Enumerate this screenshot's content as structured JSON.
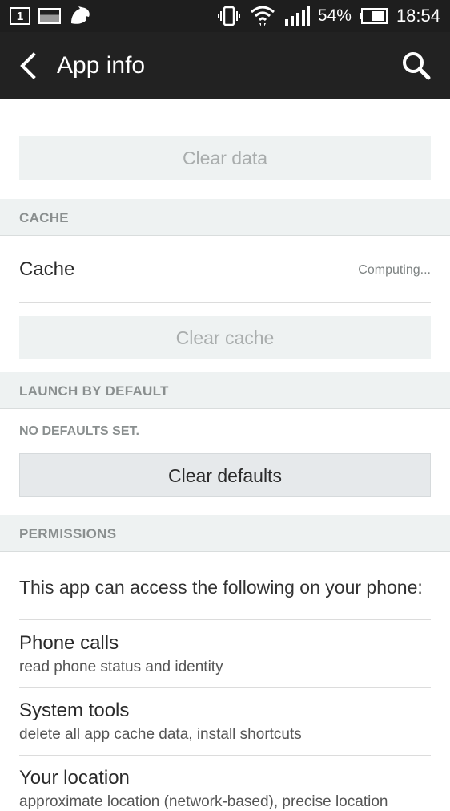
{
  "status_bar": {
    "notification_count": "1",
    "battery_percent": "54%",
    "time": "18:54"
  },
  "app_bar": {
    "title": "App info"
  },
  "storage": {
    "clear_data_label": "Clear data"
  },
  "cache": {
    "header": "CACHE",
    "label": "Cache",
    "value": "Computing...",
    "clear_cache_label": "Clear cache"
  },
  "launch_by_default": {
    "header": "LAUNCH BY DEFAULT",
    "status": "NO DEFAULTS SET.",
    "clear_defaults_label": "Clear defaults"
  },
  "permissions": {
    "header": "PERMISSIONS",
    "intro": "This app can access the following on your phone:",
    "items": [
      {
        "title": "Phone calls",
        "desc": "read phone status and identity"
      },
      {
        "title": "System tools",
        "desc": "delete all app cache data, install shortcuts"
      },
      {
        "title": "Your location",
        "desc": "approximate location (network-based), precise location"
      }
    ]
  }
}
